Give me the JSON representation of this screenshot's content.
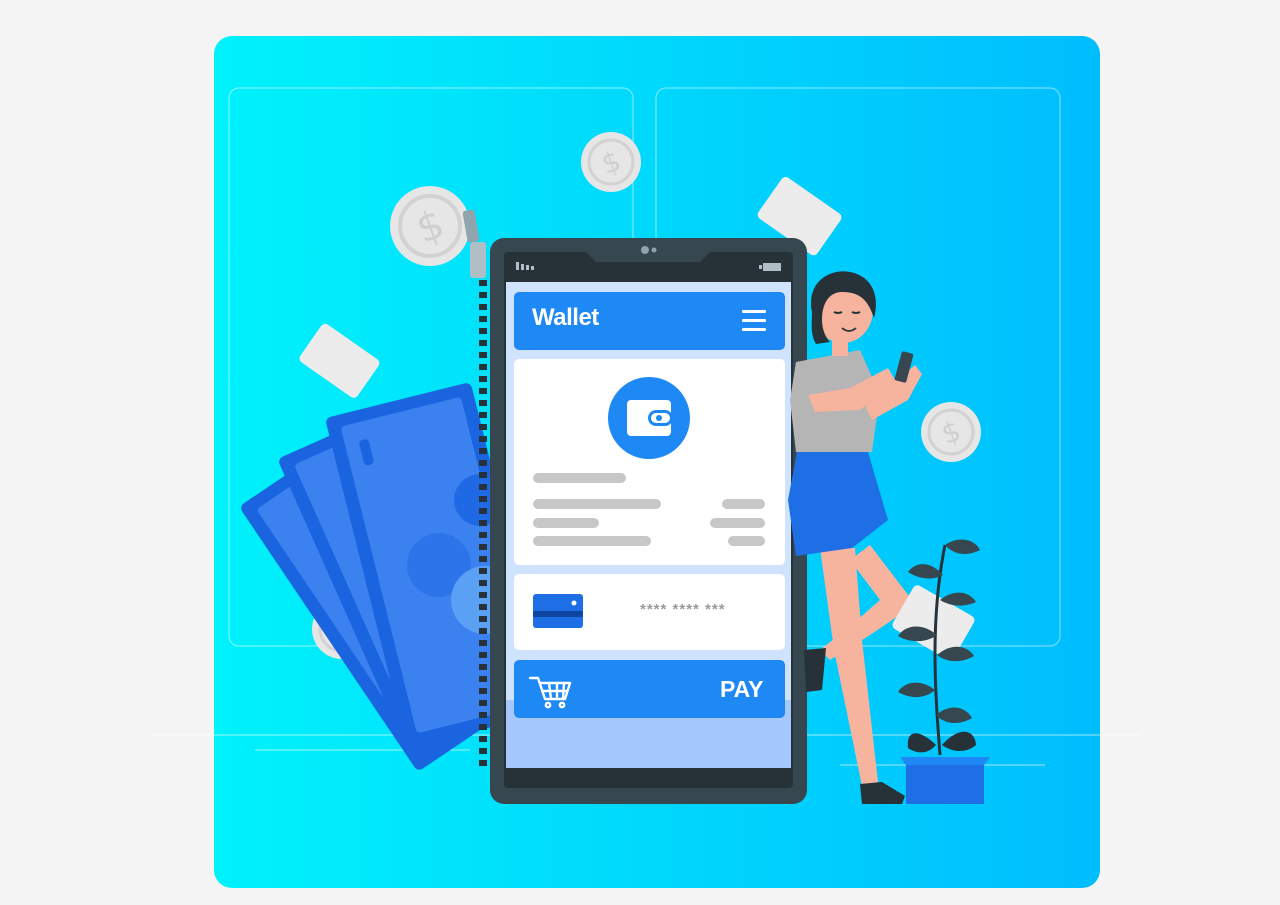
{
  "wallet_app": {
    "title": "Wallet",
    "card_number": "**** **** ***",
    "pay_label": "PAY"
  },
  "icons": {
    "menu": "hamburger-menu-icon",
    "wallet": "wallet-icon",
    "card": "credit-card-icon",
    "cart": "shopping-cart-icon",
    "coin": "dollar-coin-icon"
  },
  "colors": {
    "background_start": "#00f0fb",
    "background_end": "#00bfff",
    "accent_blue": "#1e88f5",
    "phone_frame": "#37474f",
    "screen_bg": "#cfe3ff",
    "panel": "#ffffff",
    "coin": "#e8e8e8",
    "skin": "#f6b39d",
    "shirt": "#b5b5b5",
    "shorts": "#1e6fe6"
  }
}
